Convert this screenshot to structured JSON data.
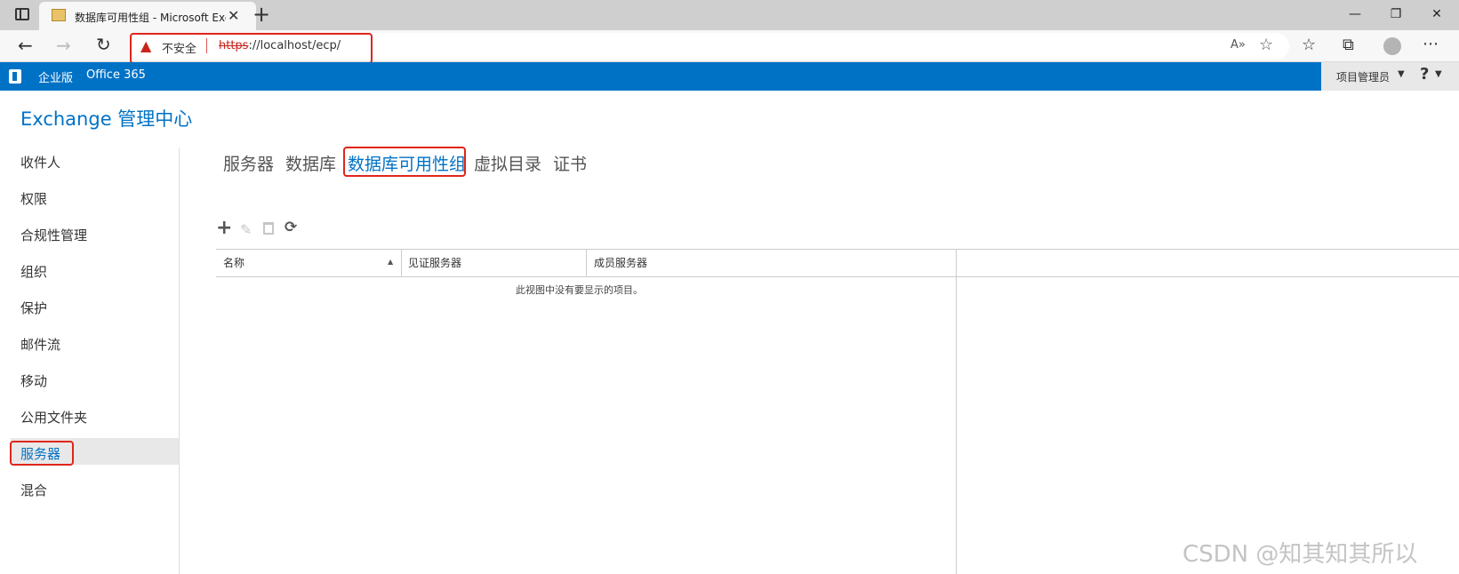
{
  "browser": {
    "tab_title": "数据库可用性组 - Microsoft Exch",
    "new_tab_symbol": "+",
    "not_secure_label": "不安全",
    "url_scheme": "https",
    "url_rest": "://localhost/ecp/"
  },
  "o365bar": {
    "enterprise_label": "企业版",
    "office365_label": "Office 365",
    "admin_label": "项目管理员",
    "help_label": "?"
  },
  "app": {
    "title": "Exchange 管理中心"
  },
  "sidebar": {
    "items": [
      {
        "label": "收件人"
      },
      {
        "label": "权限"
      },
      {
        "label": "合规性管理"
      },
      {
        "label": "组织"
      },
      {
        "label": "保护"
      },
      {
        "label": "邮件流"
      },
      {
        "label": "移动"
      },
      {
        "label": "公用文件夹"
      },
      {
        "label": "服务器",
        "selected": true
      },
      {
        "label": "混合"
      }
    ]
  },
  "tabs": [
    {
      "label": "服务器"
    },
    {
      "label": "数据库"
    },
    {
      "label": "数据库可用性组",
      "active": true
    },
    {
      "label": "虚拟目录"
    },
    {
      "label": "证书"
    }
  ],
  "toolbar": {
    "add_icon": "plus-icon",
    "edit_icon": "pencil-icon",
    "delete_icon": "trash-icon",
    "refresh_icon": "refresh-icon"
  },
  "table": {
    "columns": [
      "名称",
      "见证服务器",
      "成员服务器"
    ],
    "empty_message": "此视图中没有要显示的项目。"
  },
  "watermark": "CSDN @知其知其所以",
  "colors": {
    "brand": "#0072c6",
    "highlight": "#e0251b",
    "link": "#0072c6"
  }
}
